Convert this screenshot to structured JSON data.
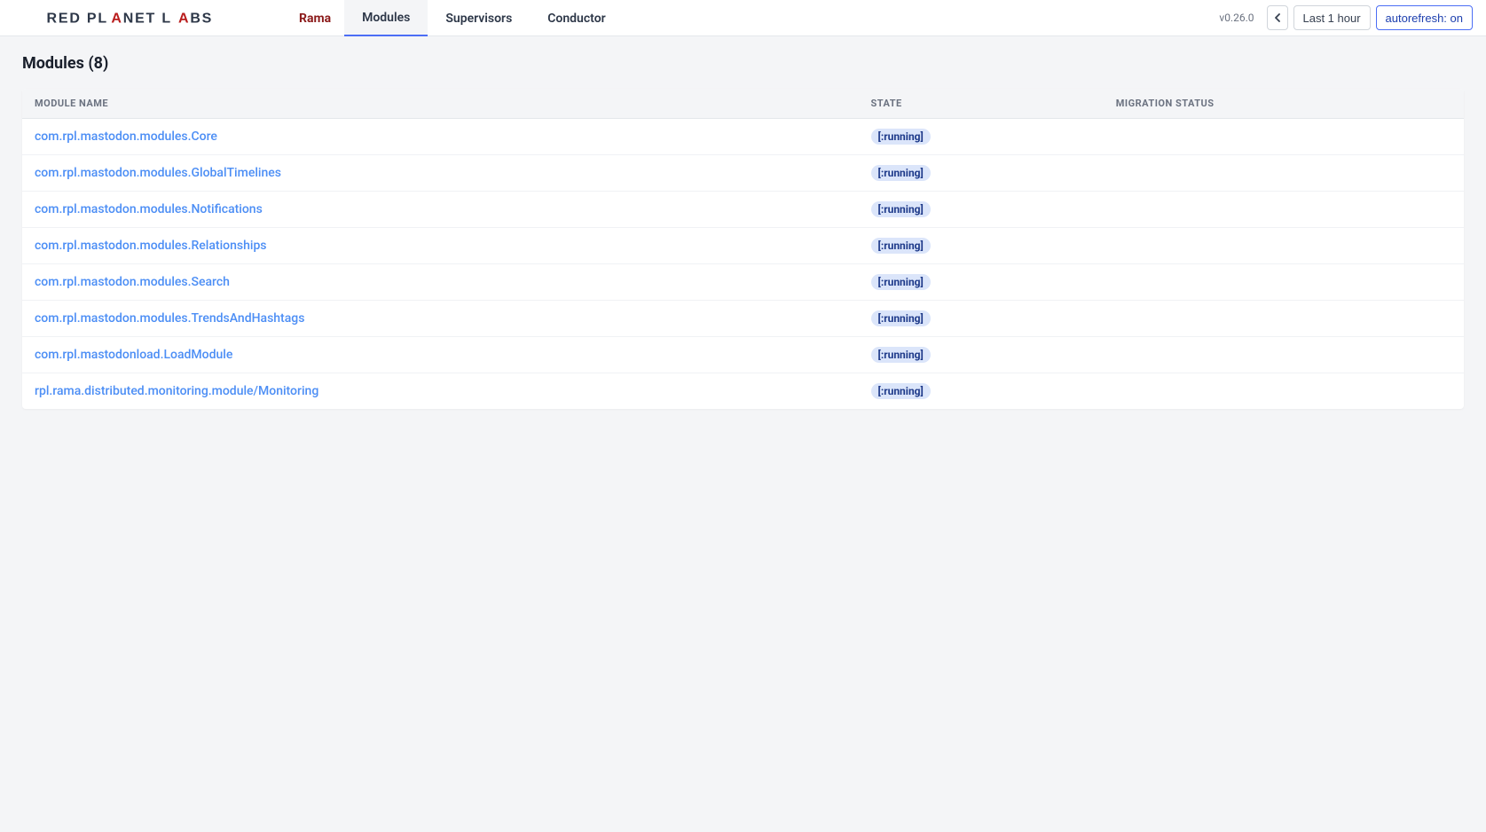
{
  "header": {
    "logo_text": "RED PLANET LABS",
    "brand_label": "Rama",
    "nav": [
      {
        "label": "Modules",
        "active": true
      },
      {
        "label": "Supervisors",
        "active": false
      },
      {
        "label": "Conductor",
        "active": false
      }
    ],
    "version": "v0.26.0",
    "time_range": "Last 1 hour",
    "autorefresh": "autorefresh: on"
  },
  "page": {
    "title": "Modules (8)"
  },
  "table": {
    "columns": {
      "name": "MODULE NAME",
      "state": "STATE",
      "migration": "MIGRATION STATUS"
    },
    "rows": [
      {
        "name": "com.rpl.mastodon.modules.Core",
        "state": "[:running]",
        "migration": ""
      },
      {
        "name": "com.rpl.mastodon.modules.GlobalTimelines",
        "state": "[:running]",
        "migration": ""
      },
      {
        "name": "com.rpl.mastodon.modules.Notifications",
        "state": "[:running]",
        "migration": ""
      },
      {
        "name": "com.rpl.mastodon.modules.Relationships",
        "state": "[:running]",
        "migration": ""
      },
      {
        "name": "com.rpl.mastodon.modules.Search",
        "state": "[:running]",
        "migration": ""
      },
      {
        "name": "com.rpl.mastodon.modules.TrendsAndHashtags",
        "state": "[:running]",
        "migration": ""
      },
      {
        "name": "com.rpl.mastodonload.LoadModule",
        "state": "[:running]",
        "migration": ""
      },
      {
        "name": "rpl.rama.distributed.monitoring.module/Monitoring",
        "state": "[:running]",
        "migration": ""
      }
    ]
  }
}
